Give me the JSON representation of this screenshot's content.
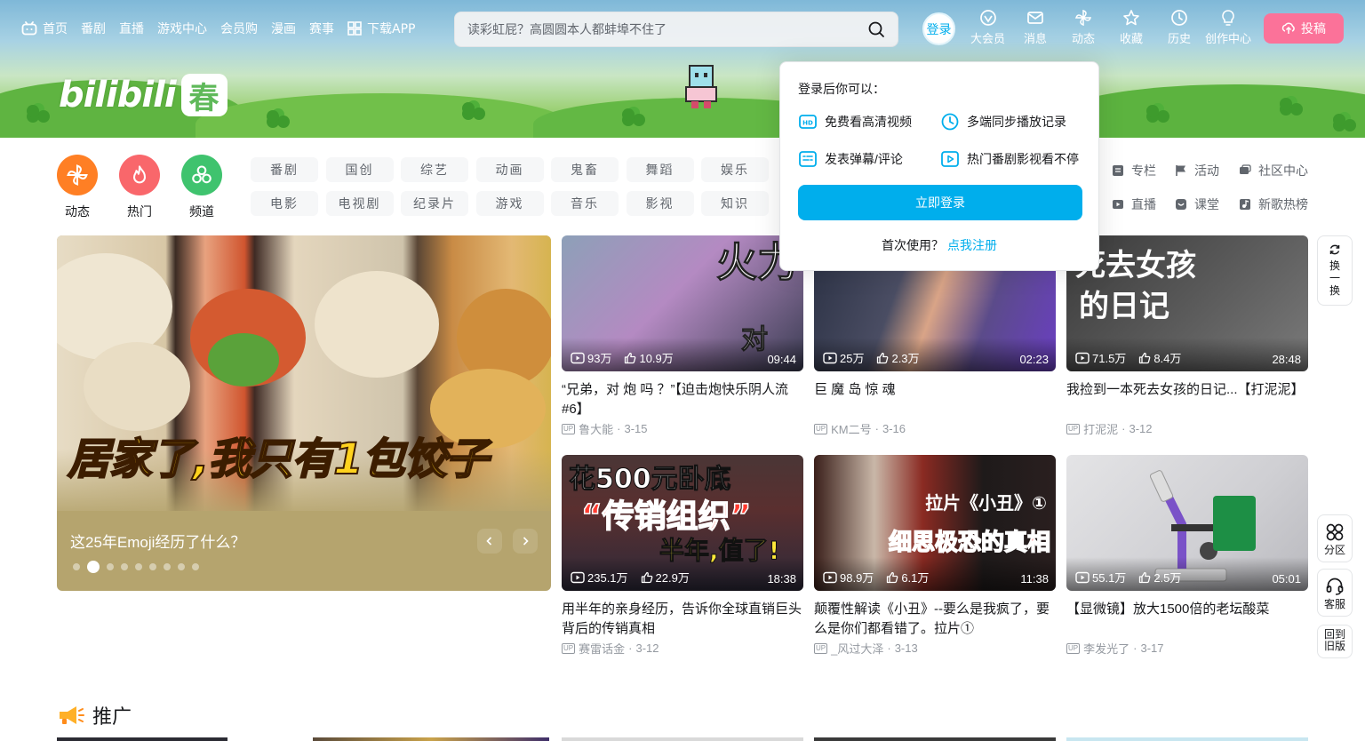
{
  "header": {
    "nav_left": [
      {
        "label": "首页",
        "icon": "tv-icon"
      },
      {
        "label": "番剧"
      },
      {
        "label": "直播"
      },
      {
        "label": "游戏中心"
      },
      {
        "label": "会员购"
      },
      {
        "label": "漫画"
      },
      {
        "label": "赛事"
      },
      {
        "label": "下载APP",
        "icon": "grid-icon"
      }
    ],
    "search_placeholder": "读彩虹屁？高圆圆本人都蚌埠不住了",
    "login_label": "登录",
    "nav_right": [
      {
        "label": "大会员",
        "icon": "vip-icon"
      },
      {
        "label": "消息",
        "icon": "mail-icon"
      },
      {
        "label": "动态",
        "icon": "windmill-icon"
      },
      {
        "label": "收藏",
        "icon": "star-icon"
      },
      {
        "label": "历史",
        "icon": "clock-icon"
      },
      {
        "label": "创作中心",
        "icon": "bulb-icon"
      }
    ],
    "upload_label": "投稿",
    "logo_text": "bilibili",
    "logo_badge": "春"
  },
  "channels": {
    "round": [
      {
        "label": "动态",
        "color": "#ff7f24",
        "icon": "windmill-icon"
      },
      {
        "label": "热门",
        "color": "#f9676b",
        "icon": "fire-icon"
      },
      {
        "label": "频道",
        "color": "#3fc36e",
        "icon": "channel-icon"
      }
    ],
    "grid": [
      "番剧",
      "国创",
      "综艺",
      "动画",
      "鬼畜",
      "舞蹈",
      "娱乐",
      "电影",
      "电视剧",
      "纪录片",
      "游戏",
      "音乐",
      "影视",
      "知识"
    ],
    "extra": [
      {
        "label": "专栏",
        "icon": "doc-icon"
      },
      {
        "label": "活动",
        "icon": "flag-icon"
      },
      {
        "label": "社区中心",
        "icon": "community-icon"
      },
      {
        "label": "直播",
        "icon": "live-icon"
      },
      {
        "label": "课堂",
        "icon": "class-icon"
      },
      {
        "label": "新歌热榜",
        "icon": "music-icon"
      }
    ]
  },
  "carousel": {
    "art_text": "居家了,我只有1包饺子",
    "title": "这25年Emoji经历了什么？",
    "dots": 9,
    "active_dot": 1
  },
  "videos": [
    {
      "title": "“兄弟，对 炮 吗 ？”【迫击炮快乐阴人流#6】",
      "views": "93万",
      "likes": "10.9万",
      "duration": "09:44",
      "author": "鲁大能",
      "date": "3-15",
      "art": "火力 对",
      "bg": [
        "#7a8aa3",
        "#a86fb8",
        "#3b3f55"
      ]
    },
    {
      "title": "巨 魔 岛 惊 魂",
      "views": "25万",
      "likes": "2.3万",
      "duration": "02:23",
      "author": "KM二号",
      "date": "3-16",
      "art": "",
      "bg": [
        "#2b3144",
        "#5b4b8a",
        "#6a3fc1"
      ]
    },
    {
      "title": "我捡到一本死去女孩的日记...【打泥泥】",
      "views": "71.5万",
      "likes": "8.4万",
      "duration": "28:48",
      "author": "打泥泥",
      "date": "3-12",
      "art": "死去女孩 的日记",
      "bg": [
        "#3a3a3a",
        "#6b6b6b",
        "#4a4a4a"
      ]
    },
    {
      "title": "用半年的亲身经历，告诉你全球直销巨头背后的传销真相",
      "views": "235.1万",
      "likes": "22.9万",
      "duration": "18:38",
      "author": "赛雷话金",
      "date": "3-12",
      "art": "花500元卧底 “传销组织” 半年,值了!",
      "bg": [
        "#3a2a2a",
        "#6b3a3a",
        "#2a2a3a"
      ]
    },
    {
      "title": "颠覆性解读《小丑》--要么是我疯了，要么是你们都看错了。拉片①",
      "views": "98.9万",
      "likes": "6.1万",
      "duration": "11:38",
      "author": "_风过大泽",
      "date": "3-13",
      "art": "拉片《小丑》① 细思极恐的真相",
      "bg": [
        "#2a1a1a",
        "#7a2a22",
        "#1a1a1a"
      ]
    },
    {
      "title": "【显微镜】放大1500倍的老坛酸菜",
      "views": "55.1万",
      "likes": "2.5万",
      "duration": "05:01",
      "author": "李发光了",
      "date": "3-17",
      "art": "",
      "bg": [
        "#cfcfd1",
        "#e7e7e9",
        "#9a9aa0"
      ]
    }
  ],
  "popover": {
    "title": "登录后你可以：",
    "items": [
      {
        "label": "免费看高清视频",
        "icon": "hd-icon"
      },
      {
        "label": "多端同步播放记录",
        "icon": "clock-icon"
      },
      {
        "label": "发表弹幕/评论",
        "icon": "danmaku-icon"
      },
      {
        "label": "热门番剧影视看不停",
        "icon": "play-icon"
      }
    ],
    "login_button": "立即登录",
    "register_prefix": "首次使用？",
    "register_link": "点我注册"
  },
  "side_tools": {
    "refresh": [
      "换",
      "一",
      "换"
    ],
    "zone": "分区",
    "service": "客服",
    "old_version": [
      "回到",
      "旧版"
    ]
  },
  "section": {
    "title": "推广",
    "icon": "megaphone-icon"
  },
  "colors": {
    "accent": "#00aeec",
    "pink": "#fb7299",
    "text": "#18191c",
    "muted": "#9499a0"
  }
}
